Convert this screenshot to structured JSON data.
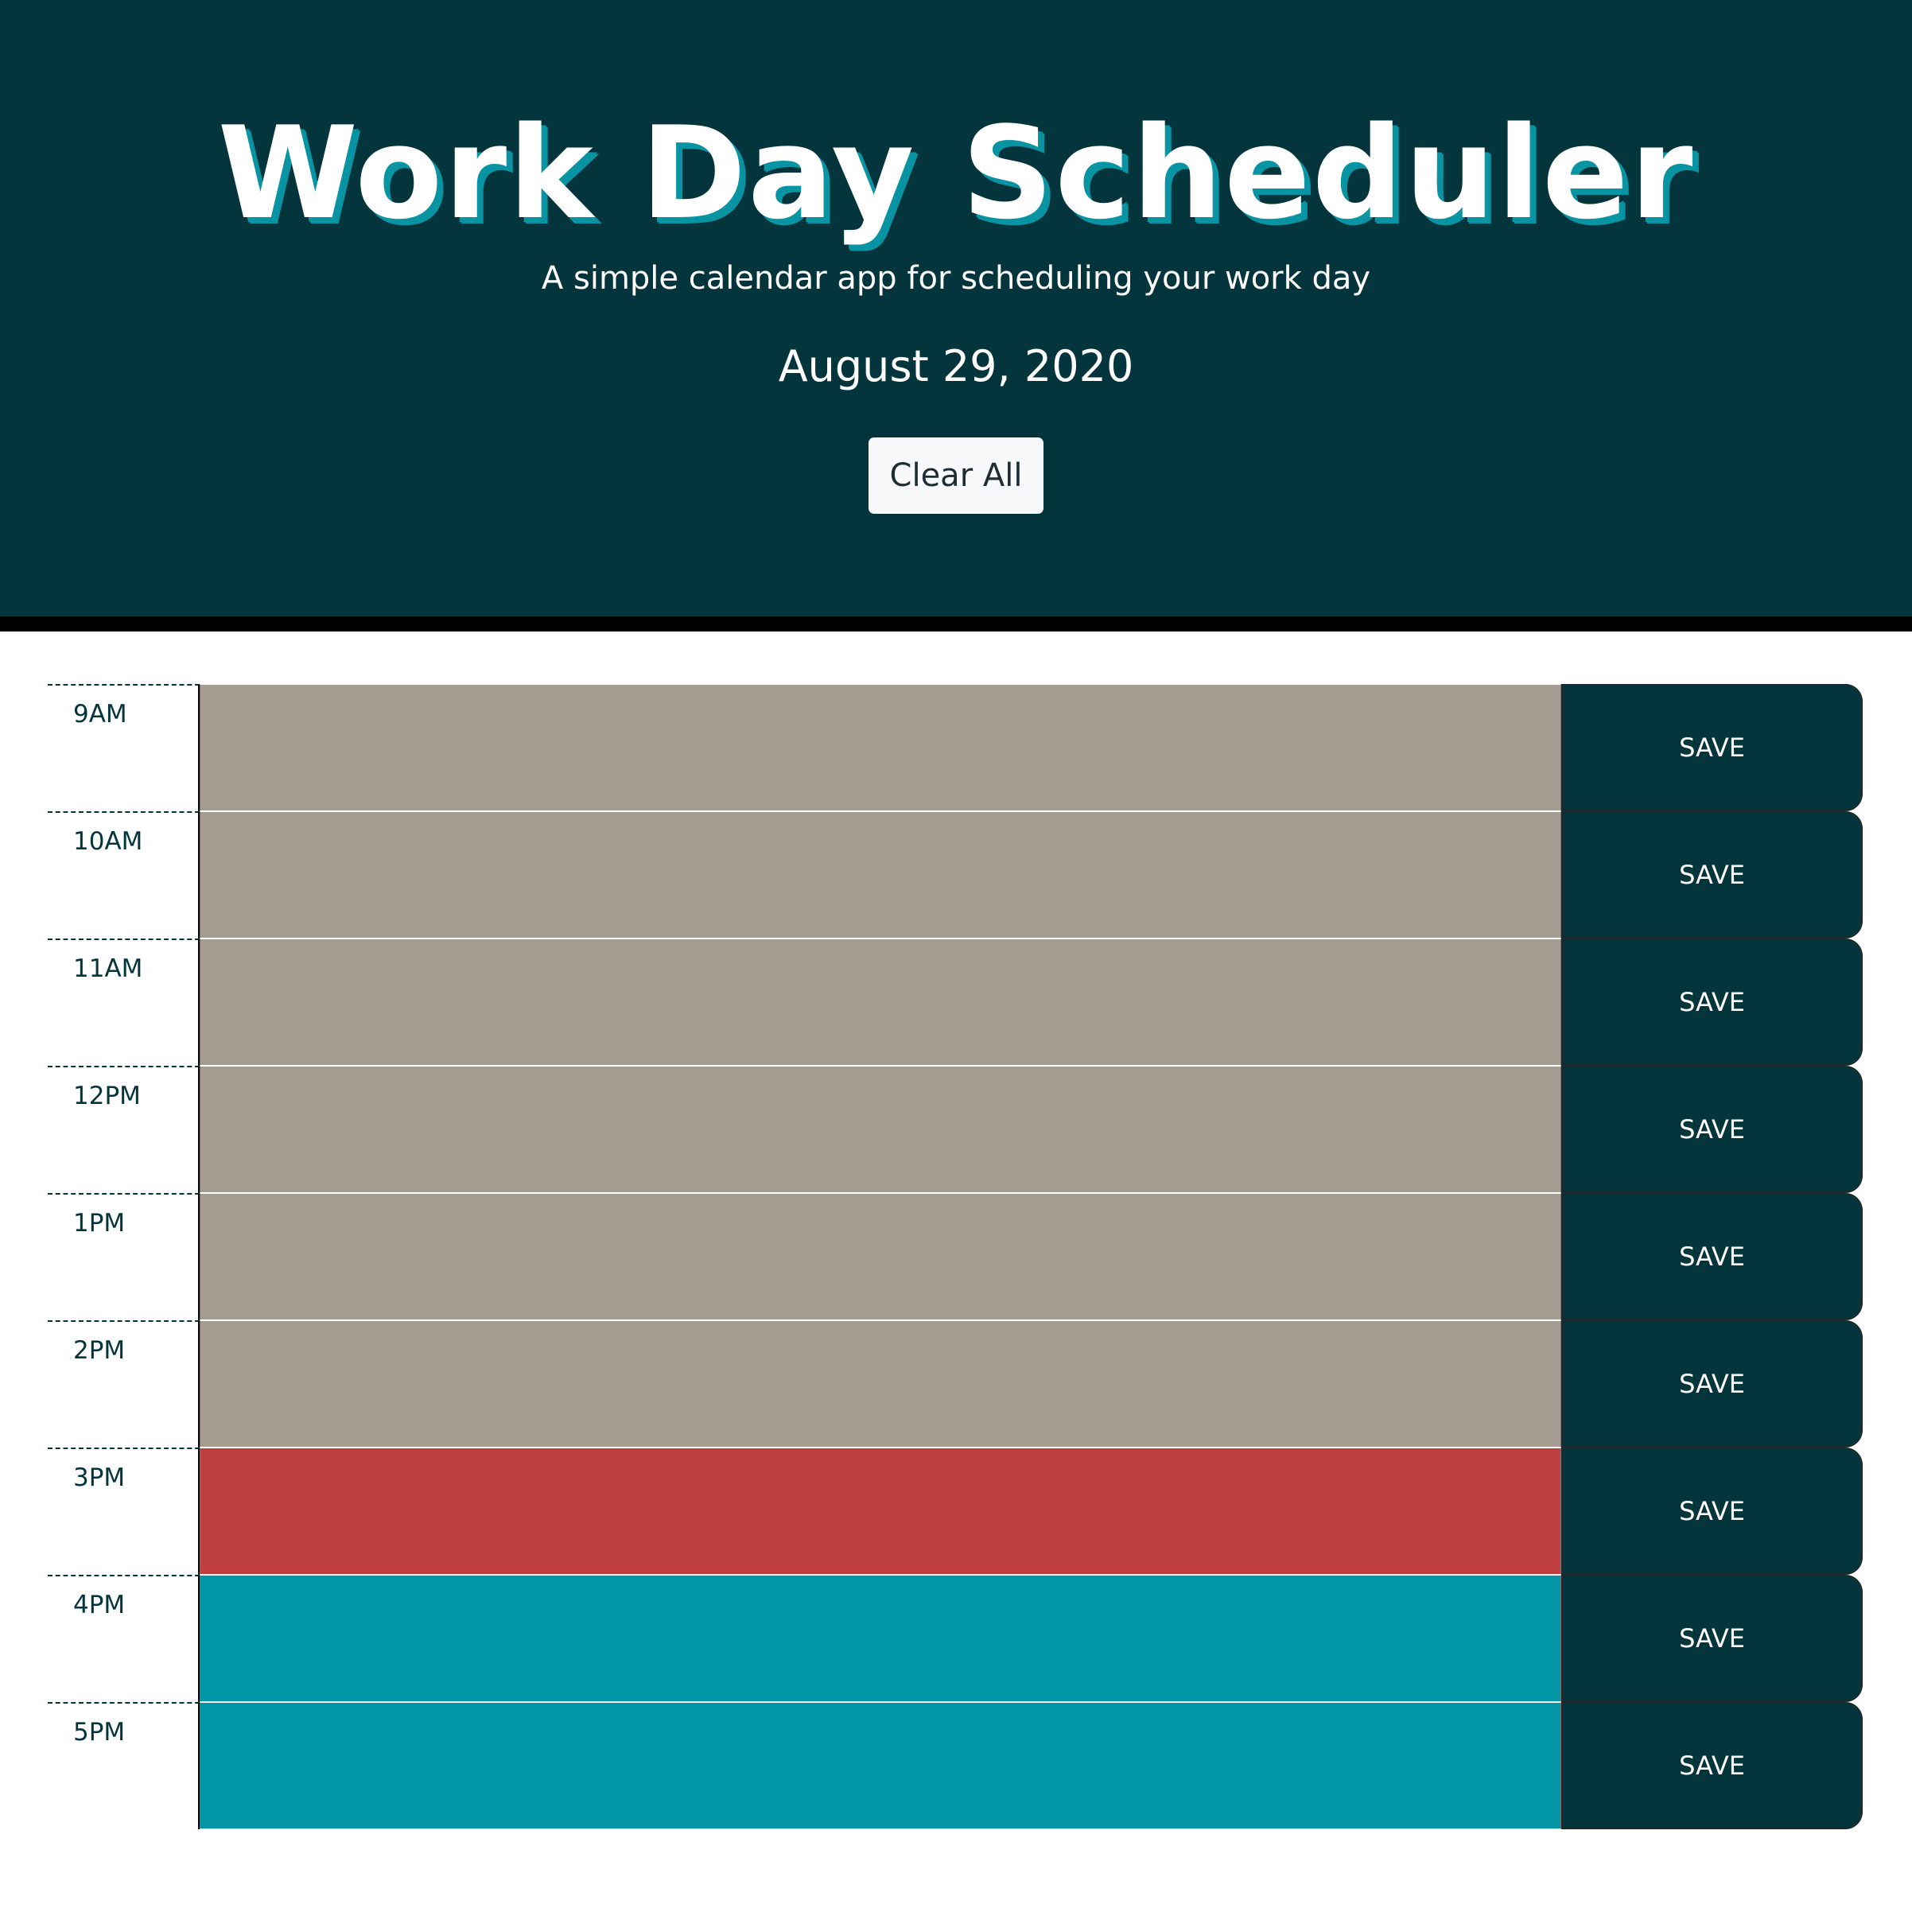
{
  "header": {
    "title": "Work Day Scheduler",
    "subtitle": "A simple calendar app for scheduling your work day",
    "date": "August 29, 2020",
    "clear_label": "Clear All"
  },
  "schedule": {
    "save_label": "SAVE",
    "rows": [
      {
        "hour": "9AM",
        "status": "past",
        "text": ""
      },
      {
        "hour": "10AM",
        "status": "past",
        "text": ""
      },
      {
        "hour": "11AM",
        "status": "past",
        "text": ""
      },
      {
        "hour": "12PM",
        "status": "past",
        "text": ""
      },
      {
        "hour": "1PM",
        "status": "past",
        "text": ""
      },
      {
        "hour": "2PM",
        "status": "past",
        "text": ""
      },
      {
        "hour": "3PM",
        "status": "present",
        "text": ""
      },
      {
        "hour": "4PM",
        "status": "future",
        "text": ""
      },
      {
        "hour": "5PM",
        "status": "future",
        "text": ""
      }
    ]
  },
  "colors": {
    "header_bg": "#04353d",
    "past": "#a69c92",
    "present": "#bf3f40",
    "future": "#0295a5",
    "title_shadow": "#0894a3"
  }
}
